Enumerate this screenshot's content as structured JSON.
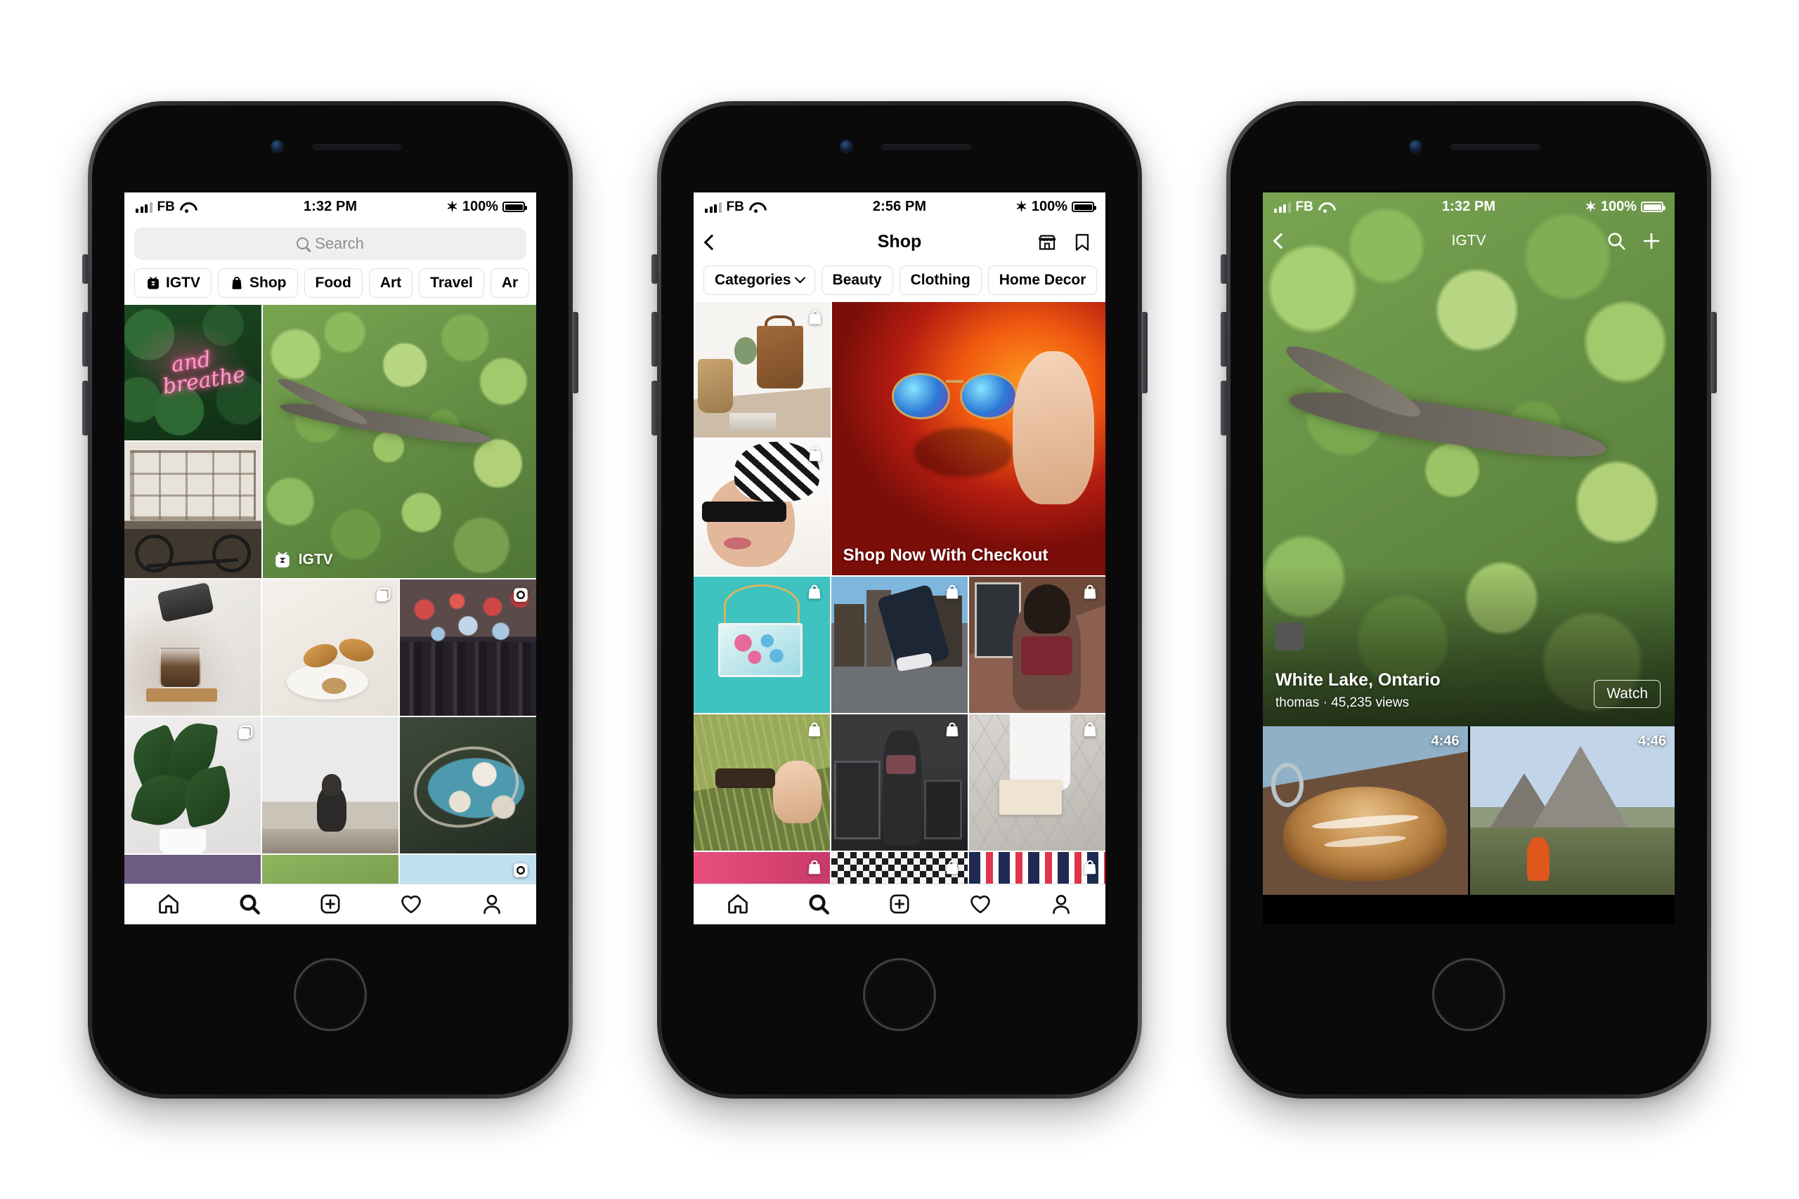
{
  "phones": [
    {
      "id": "phone-explore",
      "status_bar": {
        "signal": "signal-bars",
        "carrier": "FB",
        "wifi": "wifi-icon",
        "time": "1:32 PM",
        "bluetooth": "✶",
        "battery_pct": "100%"
      },
      "search": {
        "placeholder": "Search",
        "icon": "search-icon"
      },
      "chips": [
        {
          "label": "IGTV",
          "icon": "igtv-icon"
        },
        {
          "label": "Shop",
          "icon": "shopping-bag-icon"
        },
        {
          "label": "Food",
          "icon": ""
        },
        {
          "label": "Art",
          "icon": ""
        },
        {
          "label": "Travel",
          "icon": ""
        },
        {
          "label": "Ar",
          "icon": ""
        }
      ],
      "feature": {
        "tag_label": "IGTV",
        "tag_icon": "igtv-icon"
      },
      "grid_badges": {
        "carousel": "carousel-icon",
        "multipost": "multipost-icon"
      },
      "tabs": [
        {
          "name": "home",
          "icon": "home-icon",
          "active": false
        },
        {
          "name": "search",
          "icon": "search-icon",
          "active": true
        },
        {
          "name": "create",
          "icon": "plus-square-icon",
          "active": false
        },
        {
          "name": "activity",
          "icon": "heart-icon",
          "active": false
        },
        {
          "name": "profile",
          "icon": "person-icon",
          "active": false
        }
      ]
    },
    {
      "id": "phone-shop",
      "status_bar": {
        "signal": "signal-bars",
        "carrier": "FB",
        "wifi": "wifi-icon",
        "time": "2:56 PM",
        "bluetooth": "✶",
        "battery_pct": "100%"
      },
      "nav": {
        "back": "chevron-left-icon",
        "title": "Shop",
        "actions": [
          "storefront-icon",
          "bookmark-icon"
        ]
      },
      "chips": [
        {
          "label": "Categories",
          "icon": "chevron-down-icon"
        },
        {
          "label": "Beauty",
          "icon": ""
        },
        {
          "label": "Clothing",
          "icon": ""
        },
        {
          "label": "Home Decor",
          "icon": ""
        }
      ],
      "promo": {
        "text": "Shop Now With Checkout"
      },
      "grid_badges": {
        "shopping": "shopping-bag-badge"
      },
      "tabs": [
        {
          "name": "home",
          "icon": "home-icon",
          "active": false
        },
        {
          "name": "search",
          "icon": "search-icon",
          "active": true
        },
        {
          "name": "create",
          "icon": "plus-square-icon",
          "active": false
        },
        {
          "name": "activity",
          "icon": "heart-icon",
          "active": false
        },
        {
          "name": "profile",
          "icon": "person-icon",
          "active": false
        }
      ]
    },
    {
      "id": "phone-igtv",
      "status_bar": {
        "signal": "signal-bars",
        "carrier": "FB",
        "wifi": "wifi-icon",
        "time": "1:32 PM",
        "bluetooth": "✶",
        "battery_pct": "100%"
      },
      "nav": {
        "back": "chevron-left-icon",
        "title": "IGTV",
        "actions": [
          "search-icon",
          "plus-icon"
        ]
      },
      "hero": {
        "title": "White Lake, Ontario",
        "subtitle": "thomas · 45,235 views",
        "watch_label": "Watch"
      },
      "thumbs": [
        {
          "name": "bread-video",
          "duration": "4:46"
        },
        {
          "name": "mountain-video",
          "duration": "4:46"
        }
      ]
    }
  ],
  "colors": {
    "bezel": "#2b2d30",
    "screen_bg": "#ffffff",
    "chip_border": "#e0e0e0",
    "search_bg": "#efefef",
    "placeholder": "#8e8e8e",
    "tabbar_border": "#dbdbdb",
    "promo_bg": "#c0280f"
  }
}
